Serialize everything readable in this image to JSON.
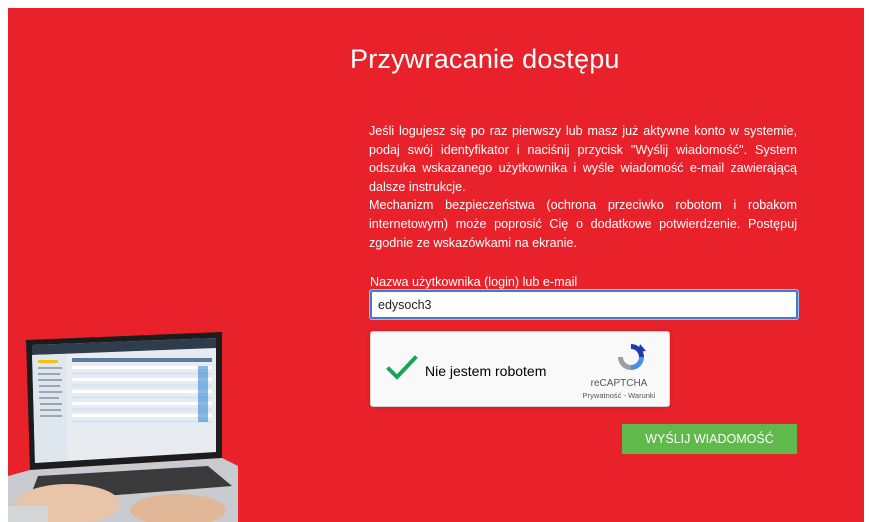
{
  "page": {
    "title": "Przywracanie dostępu",
    "description_paragraphs": [
      "Jeśli logujesz się po raz pierwszy lub masz już aktywne konto w systemie, podaj swój identyfikator i naciśnij przycisk \"Wyślij wiadomość\". System odszuka wskazanego użytkownika i wyśle wiadomość e-mail zawierającą dalsze instrukcje.",
      "Mechanizm bezpieczeństwa (ochrona przeciwko robotom i robakom internetowym) może poprosić Cię o dodatkowe potwierdzenie. Postępuj zgodnie ze wskazówkami na ekranie."
    ]
  },
  "form": {
    "username_label": "Nazwa użytkownika (login) lub e-mail",
    "username_value": "edysoch3"
  },
  "captcha": {
    "label": "Nie jestem robotem",
    "checked": true,
    "brand": "reCAPTCHA",
    "privacy_link": "Prywatność",
    "separator": " - ",
    "terms_link": "Warunki"
  },
  "actions": {
    "send_label": "WYŚLIJ WIADOMOŚĆ"
  },
  "colors": {
    "background": "#e8212a",
    "button": "#5fb94b",
    "checkmark": "#1aa25a",
    "input_focus_border": "#3d7dcc"
  },
  "icons": {
    "captcha_check": "check-icon",
    "captcha_logo": "recaptcha-logo-icon",
    "illustration": "laptop-illustration"
  }
}
